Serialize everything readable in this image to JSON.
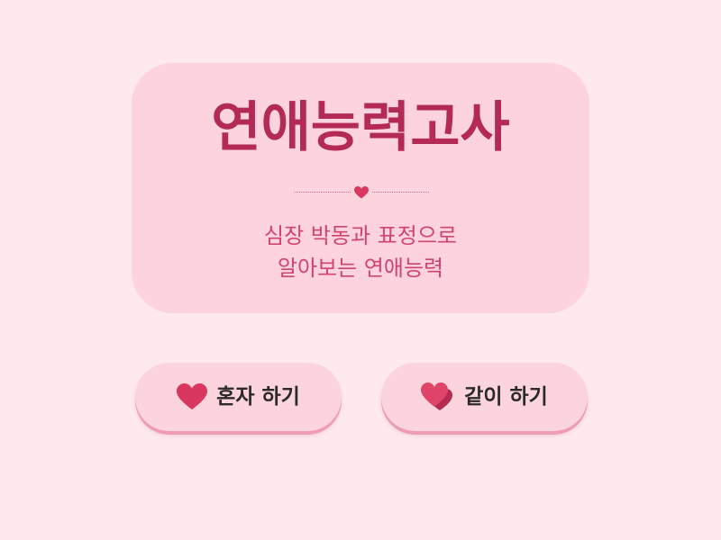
{
  "card": {
    "title": "연애능력고사",
    "subtitle_line1": "심장 박동과 표정으로",
    "subtitle_line2": "알아보는 연애능력",
    "divider_icon": "heart-icon"
  },
  "buttons": {
    "solo": {
      "label": "혼자 하기",
      "icon": "heart-icon"
    },
    "together": {
      "label": "같이 하기",
      "icon": "double-heart-icon"
    }
  },
  "colors": {
    "background": "#fde9ee",
    "card": "#fdd3dd",
    "title": "#b32a56",
    "subtitle": "#d04470",
    "heart": "#d9375f",
    "button": "#fcd4de",
    "button_shadow": "#ef9db2"
  }
}
